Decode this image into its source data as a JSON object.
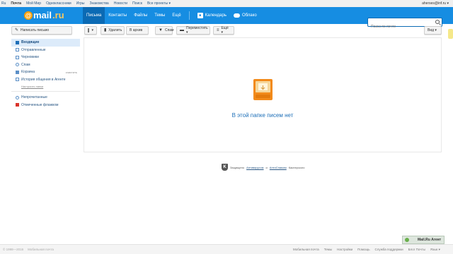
{
  "portal": {
    "links": [
      "Ru",
      "Почта",
      "Мой Мир",
      "Одноклассники",
      "Игры",
      "Знакомства",
      "Новости",
      "Поиск",
      "Все проекты ▾"
    ],
    "user": "aherses@inf.ru ▾"
  },
  "header": {
    "logo_prefix": "@",
    "logo_text": "mail",
    "logo_suffix": ".ru",
    "nav": [
      "Письма",
      "Контакты",
      "Файлы",
      "Темы",
      "Ещё"
    ],
    "calendar_label": "Календарь",
    "cloud_label": "Облако",
    "search_placeholder": "Поиск по почте"
  },
  "toolbar": {
    "compose": "Написать письмо",
    "select_caret": "▾",
    "delete": "Удалить",
    "archive": "В архив",
    "spam": "Спам",
    "move": "Переместить ▾",
    "more": "Ещё ▾",
    "view": "Вид ▾"
  },
  "sidebar": {
    "folders": [
      {
        "label": "Входящие"
      },
      {
        "label": "Отправленные"
      },
      {
        "label": "Черновики"
      },
      {
        "label": "Спам"
      },
      {
        "label": "Корзина",
        "action": "очистить"
      },
      {
        "label": "История общения в Агенте"
      }
    ],
    "configure": "Настроить папки",
    "filters": [
      "Непрочитанные",
      "Отмеченные флажком"
    ]
  },
  "main": {
    "empty_text": "В этой папке писем нет",
    "kaspersky_prefix": "Защищено",
    "kaspersky_link1": "Антивирусом",
    "kaspersky_sep": "и",
    "kaspersky_link2": "АнтиСпамом",
    "kaspersky_suffix": "Касперского"
  },
  "footer": {
    "left": [
      "© 1998—2016",
      "Мобильная почта"
    ],
    "links": [
      "Мобильная почта",
      "Темы",
      "Настройки",
      "Помощь",
      "Служба поддержки",
      "Блог Почты",
      "Язык ▾"
    ],
    "agent": "Mail.Ru Агент"
  },
  "colors": {
    "brand": "#168de2",
    "accent": "#ff9e00",
    "active_folder": "#dcebfa"
  }
}
